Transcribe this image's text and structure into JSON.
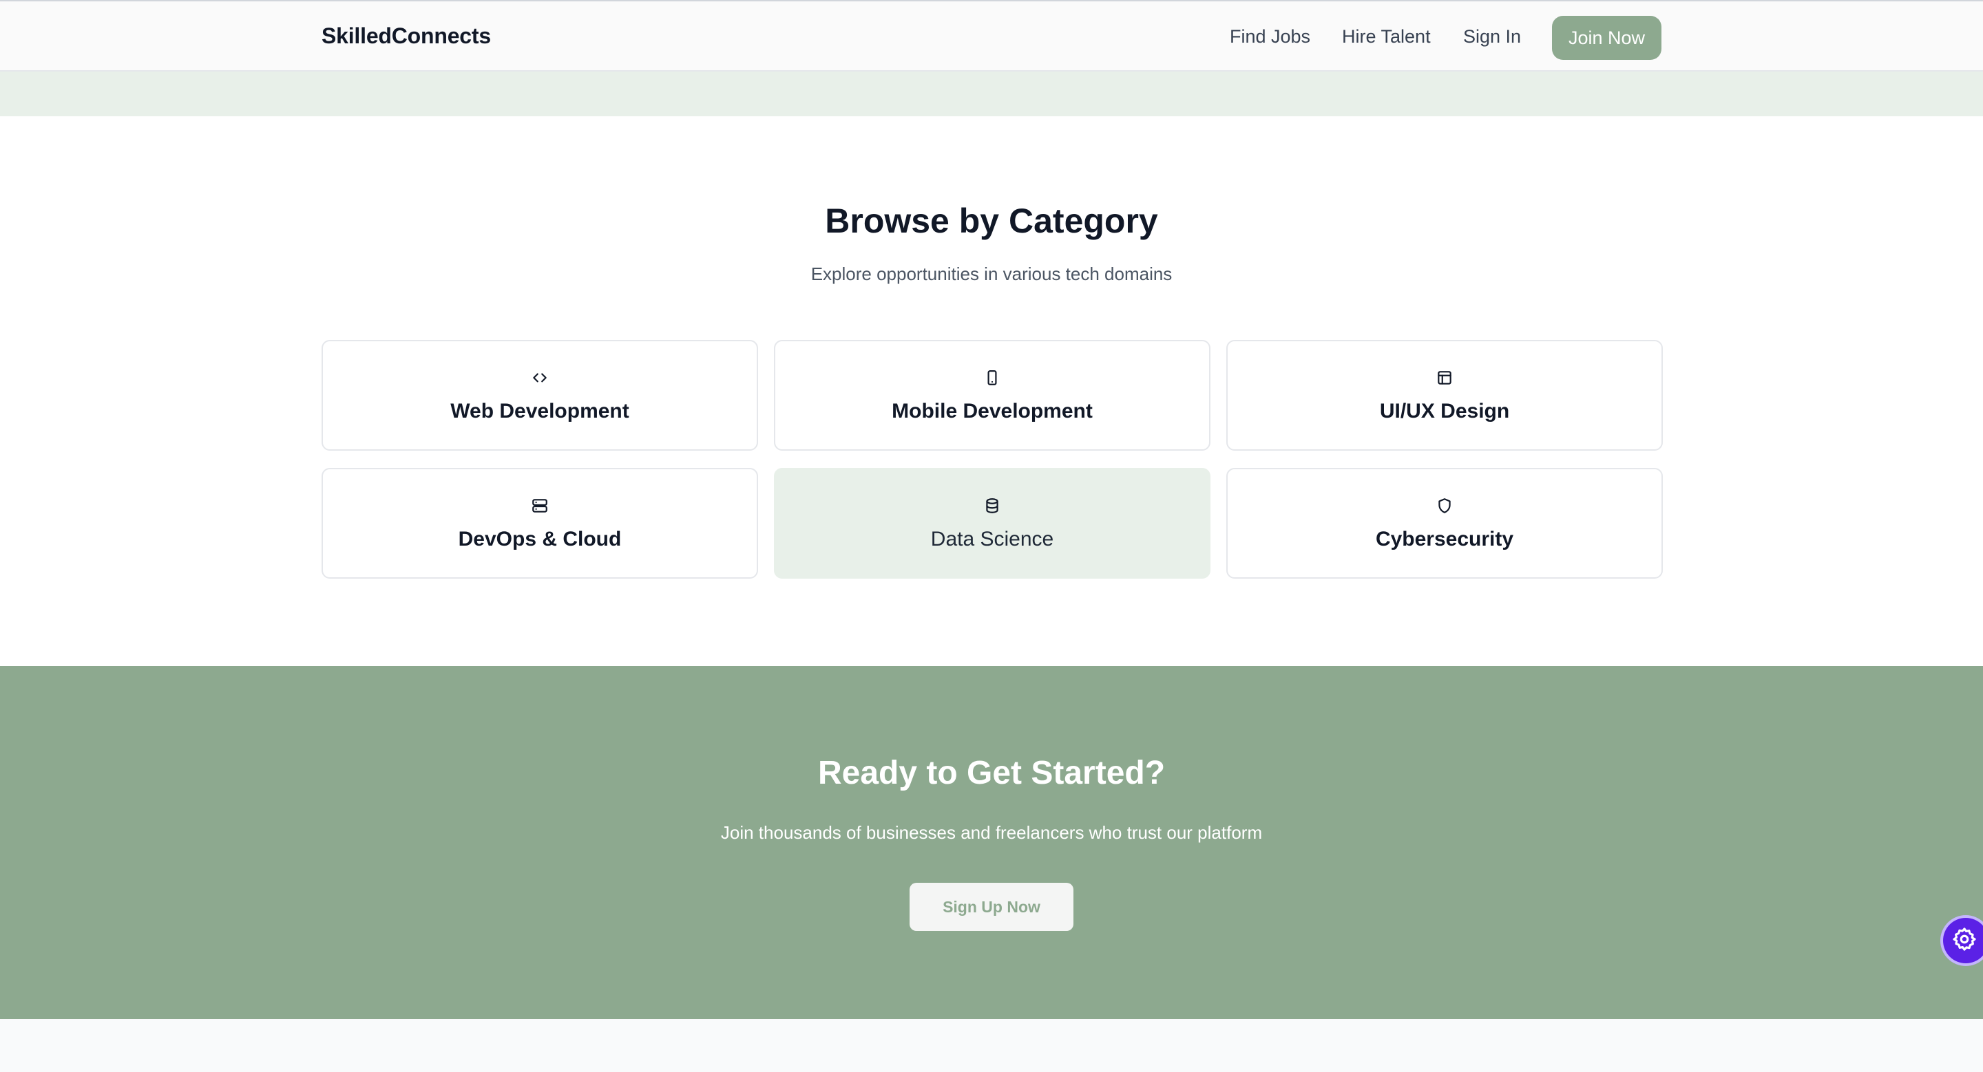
{
  "header": {
    "brand": "SkilledConnects",
    "nav": {
      "find_jobs": "Find Jobs",
      "hire_talent": "Hire Talent",
      "sign_in": "Sign In"
    },
    "join_label": "Join Now"
  },
  "categories": {
    "title": "Browse by Category",
    "subtitle": "Explore opportunities in various tech domains",
    "items": [
      {
        "label": "Web Development",
        "icon": "code-icon"
      },
      {
        "label": "Mobile Development",
        "icon": "smartphone-icon"
      },
      {
        "label": "UI/UX Design",
        "icon": "layout-icon"
      },
      {
        "label": "DevOps & Cloud",
        "icon": "server-icon"
      },
      {
        "label": "Data Science",
        "icon": "database-icon",
        "selected": true
      },
      {
        "label": "Cybersecurity",
        "icon": "shield-icon"
      }
    ]
  },
  "cta": {
    "title": "Ready to Get Started?",
    "subtitle": "Join thousands of businesses and freelancers who trust our platform",
    "button_label": "Sign Up Now"
  },
  "floating_button": {
    "icon": "gear-icon"
  },
  "colors": {
    "accent": "#8da98f",
    "accent_light": "#e8f0e9",
    "floating": "#5b21e6"
  }
}
